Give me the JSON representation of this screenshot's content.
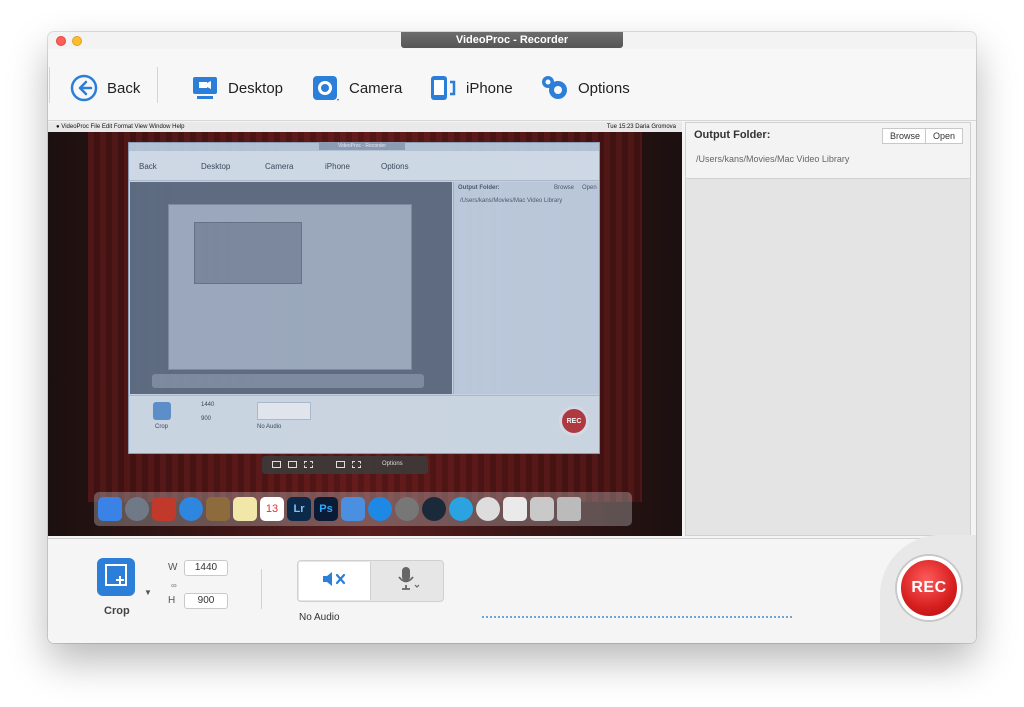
{
  "window": {
    "title": "VideoProc - Recorder"
  },
  "toolbar": {
    "back_label": "Back",
    "desktop_label": "Desktop",
    "camera_label": "Camera",
    "iphone_label": "iPhone",
    "options_label": "Options"
  },
  "screen_preview": {
    "menubar": "VideoProc   File   Edit   Format   View   Window   Help",
    "menubar_right": "Tue 15:23   Daria Gromova",
    "inner_title": "VideoProc - Recorder",
    "inner_toolbar": [
      "Back",
      "Desktop",
      "Camera",
      "iPhone",
      "Options"
    ],
    "inner_output_label": "Output Folder:",
    "inner_output_path": "/Users/kans/Movies/Mac Video Library",
    "inner_browse": "Browse",
    "inner_open": "Open",
    "inner_w": "1440",
    "inner_h": "900",
    "inner_crop": "Crop",
    "inner_no_audio": "No Audio",
    "inner_rec": "REC",
    "capture_options": "Options",
    "dock_date": "13",
    "dock_lr": "Lr",
    "dock_ps": "Ps"
  },
  "output": {
    "label": "Output Folder:",
    "path": "/Users/kans/Movies/Mac Video Library",
    "browse": "Browse",
    "open": "Open"
  },
  "bottom": {
    "crop_label": "Crop",
    "w_label": "W",
    "h_label": "H",
    "width_value": "1440",
    "height_value": "900",
    "audio_label": "No Audio",
    "rec_label": "REC"
  },
  "colors": {
    "accent": "#2c7fd8",
    "rec": "#d61e1e"
  }
}
